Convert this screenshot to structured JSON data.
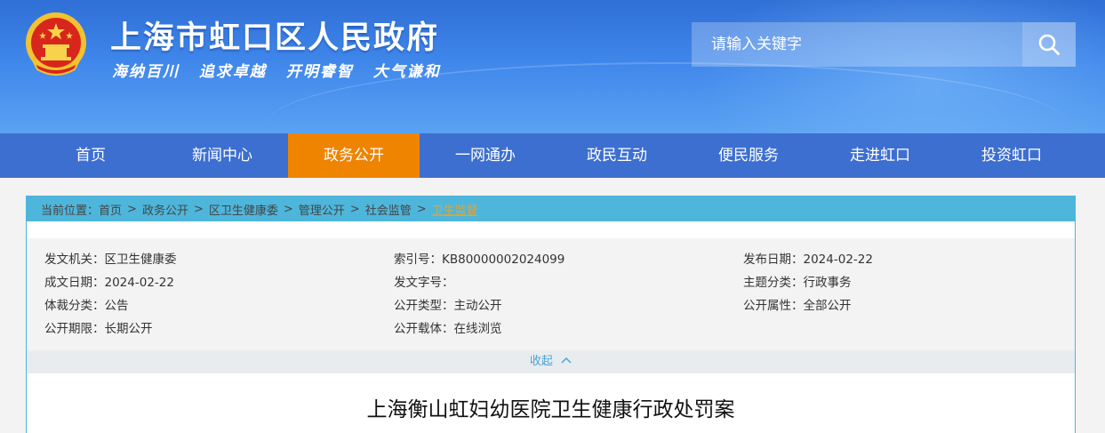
{
  "header": {
    "site_title": "上海市虹口区人民政府",
    "slogan": "海纳百川  追求卓越  开明睿智  大气谦和",
    "search_placeholder": "请输入关键字"
  },
  "nav": {
    "items": [
      "首页",
      "新闻中心",
      "政务公开",
      "一网通办",
      "政民互动",
      "便民服务",
      "走进虹口",
      "投资虹口"
    ],
    "active": "政务公开"
  },
  "breadcrumb": {
    "label": "当前位置：",
    "items": [
      "首页",
      "政务公开",
      "区卫生健康委",
      "管理公开",
      "社会监管",
      "卫生监督"
    ],
    "separator": ">"
  },
  "meta": {
    "rows": [
      [
        "发文机关：区卫生健康委",
        "索引号：KB80000002024099",
        "发布日期：2024-02-22"
      ],
      [
        "成文日期：2024-02-22",
        "发文字号：",
        "主题分类：行政事务"
      ],
      [
        "体裁分类：公告",
        "公开类型：主动公开",
        "公开属性：全部公开"
      ],
      [
        "公开期限：长期公开",
        "公开载体：在线浏览",
        ""
      ]
    ],
    "collapse_label": "收起"
  },
  "document": {
    "title": "上海衡山虹妇幼医院卫生健康行政处罚案"
  },
  "colors": {
    "header_blue": "#3f86ea",
    "nav_blue": "#3d6fd0",
    "nav_active": "#ee8400",
    "breadcrumb_bg": "#4eb6db",
    "breadcrumb_current": "#f0a020"
  }
}
